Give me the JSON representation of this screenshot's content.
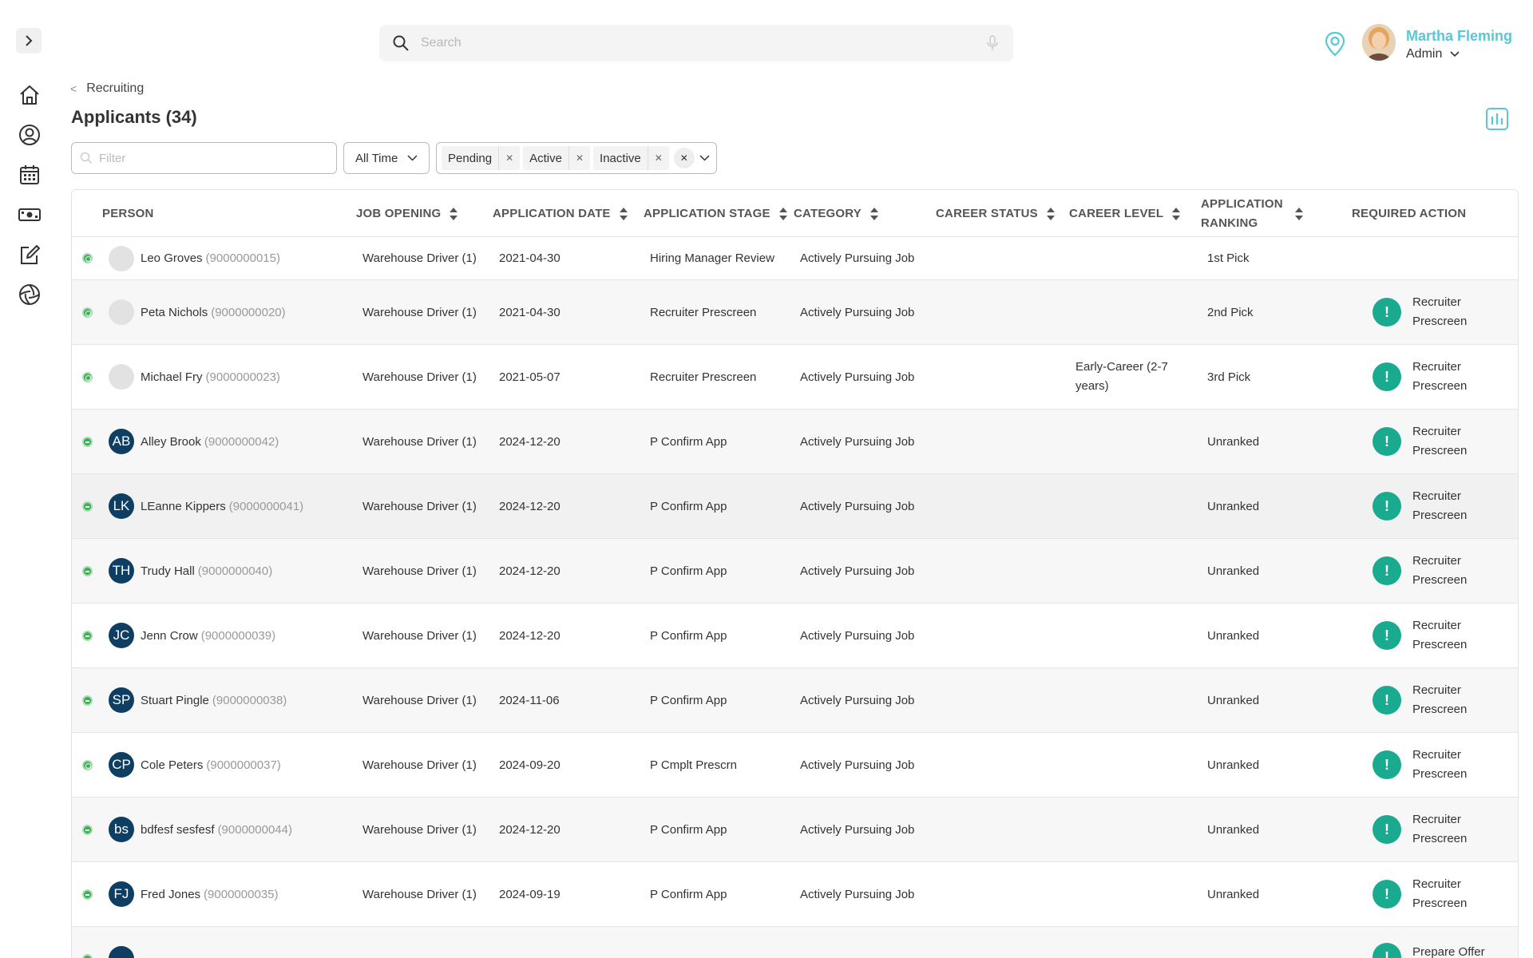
{
  "search": {
    "placeholder": "Search"
  },
  "user": {
    "name": "Martha Fleming",
    "role": "Admin"
  },
  "breadcrumb": {
    "back_label": "Recruiting"
  },
  "page": {
    "title": "Applicants (34)"
  },
  "filters": {
    "filter_placeholder": "Filter",
    "time_range": "All Time",
    "status_tags": [
      "Pending",
      "Active",
      "Inactive"
    ]
  },
  "table": {
    "columns": {
      "person": "PERSON",
      "job_opening": "JOB OPENING",
      "application_date": "APPLICATION DATE",
      "application_stage": "APPLICATION STAGE",
      "category": "CATEGORY",
      "career_status": "CAREER STATUS",
      "career_level": "CAREER LEVEL",
      "application_ranking_1": "APPLICATION",
      "application_ranking_2": "RANKING",
      "required_action": "REQUIRED ACTION"
    },
    "rows": [
      {
        "initials": "",
        "name": "Leo Groves",
        "id": "(9000000015)",
        "job": "Warehouse Driver (1)",
        "date": "2021-04-30",
        "stage": "Hiring Manager Review",
        "category": "Actively Pursuing Job",
        "career_status": "",
        "career_level": "",
        "ranking": "1st Pick",
        "action": ""
      },
      {
        "initials": "",
        "name": "Peta Nichols",
        "id": "(9000000020)",
        "job": "Warehouse Driver (1)",
        "date": "2021-04-30",
        "stage": "Recruiter Prescreen",
        "category": "Actively Pursuing Job",
        "career_status": "",
        "career_level": "",
        "ranking": "2nd Pick",
        "action": "Recruiter Prescreen"
      },
      {
        "initials": "",
        "name": "Michael Fry",
        "id": "(9000000023)",
        "job": "Warehouse Driver (1)",
        "date": "2021-05-07",
        "stage": "Recruiter Prescreen",
        "category": "Actively Pursuing Job",
        "career_status": "",
        "career_level": "Early-Career (2-7 years)",
        "ranking": "3rd Pick",
        "action": "Recruiter Prescreen"
      },
      {
        "initials": "AB",
        "name": "Alley Brook",
        "id": "(9000000042)",
        "job": "Warehouse Driver (1)",
        "date": "2024-12-20",
        "stage": "P Confirm App",
        "category": "Actively Pursuing Job",
        "career_status": "",
        "career_level": "",
        "ranking": "Unranked",
        "action": "Recruiter Prescreen"
      },
      {
        "initials": "LK",
        "name": "LEanne Kippers",
        "id": "(9000000041)",
        "job": "Warehouse Driver (1)",
        "date": "2024-12-20",
        "stage": "P Confirm App",
        "category": "Actively Pursuing Job",
        "career_status": "",
        "career_level": "",
        "ranking": "Unranked",
        "action": "Recruiter Prescreen"
      },
      {
        "initials": "TH",
        "name": "Trudy Hall",
        "id": "(9000000040)",
        "job": "Warehouse Driver (1)",
        "date": "2024-12-20",
        "stage": "P Confirm App",
        "category": "Actively Pursuing Job",
        "career_status": "",
        "career_level": "",
        "ranking": "Unranked",
        "action": "Recruiter Prescreen"
      },
      {
        "initials": "JC",
        "name": "Jenn Crow",
        "id": "(9000000039)",
        "job": "Warehouse Driver (1)",
        "date": "2024-12-20",
        "stage": "P Confirm App",
        "category": "Actively Pursuing Job",
        "career_status": "",
        "career_level": "",
        "ranking": "Unranked",
        "action": "Recruiter Prescreen"
      },
      {
        "initials": "SP",
        "name": "Stuart Pingle",
        "id": "(9000000038)",
        "job": "Warehouse Driver (1)",
        "date": "2024-11-06",
        "stage": "P Confirm App",
        "category": "Actively Pursuing Job",
        "career_status": "",
        "career_level": "",
        "ranking": "Unranked",
        "action": "Recruiter Prescreen"
      },
      {
        "initials": "CP",
        "name": "Cole Peters",
        "id": "(9000000037)",
        "job": "Warehouse Driver (1)",
        "date": "2024-09-20",
        "stage": "P Cmplt Prescrn",
        "category": "Actively Pursuing Job",
        "career_status": "",
        "career_level": "",
        "ranking": "Unranked",
        "action": "Recruiter Prescreen"
      },
      {
        "initials": "bs",
        "name": "bdfesf sesfesf",
        "id": "(9000000044)",
        "job": "Warehouse Driver (1)",
        "date": "2024-12-20",
        "stage": "P Confirm App",
        "category": "Actively Pursuing Job",
        "career_status": "",
        "career_level": "",
        "ranking": "Unranked",
        "action": "Recruiter Prescreen"
      },
      {
        "initials": "FJ",
        "name": "Fred Jones",
        "id": "(9000000035)",
        "job": "Warehouse Driver (1)",
        "date": "2024-09-19",
        "stage": "P Confirm App",
        "category": "Actively Pursuing Job",
        "career_status": "",
        "career_level": "",
        "ranking": "Unranked",
        "action": "Recruiter Prescreen"
      },
      {
        "initials": "",
        "name": "",
        "id": "",
        "job": "",
        "date": "",
        "stage": "",
        "category": "",
        "career_status": "",
        "career_level": "",
        "ranking": "",
        "action": "Prepare Offer"
      }
    ]
  }
}
